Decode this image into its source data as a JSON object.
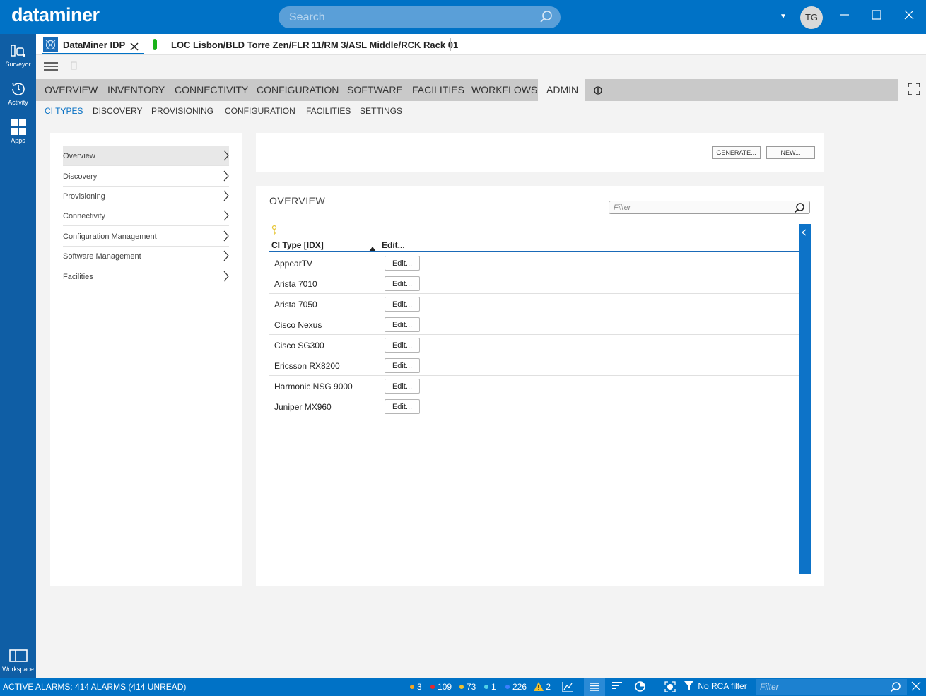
{
  "app": {
    "logo": "dataminer"
  },
  "search": {
    "placeholder": "Search"
  },
  "user": {
    "initials": "TG"
  },
  "rail": {
    "surveyor": "Surveyor",
    "activity": "Activity",
    "apps": "Apps",
    "workspace": "Workspace"
  },
  "tabs": [
    {
      "label": "DataMiner IDP"
    },
    {
      "label": "LOC Lisbon/BLD Torre Zen/FLR 11/RM 3/ASL Middle/RCK Rack 01",
      "status_color": "#19b219"
    }
  ],
  "main_nav": [
    "OVERVIEW",
    "INVENTORY",
    "CONNECTIVITY",
    "CONFIGURATION",
    "SOFTWARE",
    "FACILITIES",
    "WORKFLOWS",
    "ADMIN"
  ],
  "main_nav_active": "ADMIN",
  "sub_nav": [
    "CI TYPES",
    "DISCOVERY",
    "PROVISIONING",
    "CONFIGURATION",
    "FACILITIES",
    "SETTINGS"
  ],
  "sub_nav_active": "CI TYPES",
  "side_menu": [
    "Overview",
    "Discovery",
    "Provisioning",
    "Connectivity",
    "Configuration Management",
    "Software Management",
    "Facilities"
  ],
  "side_menu_active": "Overview",
  "actions": {
    "generate": "GENERATE...",
    "new": "NEW..."
  },
  "overview": {
    "title": "OVERVIEW",
    "filter_placeholder": "Filter",
    "columns": [
      "CI Type [IDX]",
      "Edit..."
    ],
    "rows": [
      {
        "name": "AppearTV",
        "edit": "Edit..."
      },
      {
        "name": "Arista 7010",
        "edit": "Edit..."
      },
      {
        "name": "Arista 7050",
        "edit": "Edit..."
      },
      {
        "name": "Cisco Nexus",
        "edit": "Edit..."
      },
      {
        "name": "Cisco SG300",
        "edit": "Edit..."
      },
      {
        "name": "Ericsson RX8200",
        "edit": "Edit..."
      },
      {
        "name": "Harmonic NSG 9000",
        "edit": "Edit..."
      },
      {
        "name": "Juniper MX960",
        "edit": "Edit..."
      }
    ]
  },
  "status": {
    "active_alarms": "ACTIVE ALARMS: 414 ALARMS (414 UNREAD)",
    "counts": [
      {
        "value": "3",
        "color": "#f5a623"
      },
      {
        "value": "109",
        "color": "#e8262b"
      },
      {
        "value": "73",
        "color": "#f2c12e"
      },
      {
        "value": "1",
        "color": "#4fd1e8"
      },
      {
        "value": "226",
        "color": "#3a7fff"
      }
    ],
    "warning_count": "2",
    "rca": "No RCA filter",
    "filter_placeholder": "Filter"
  }
}
